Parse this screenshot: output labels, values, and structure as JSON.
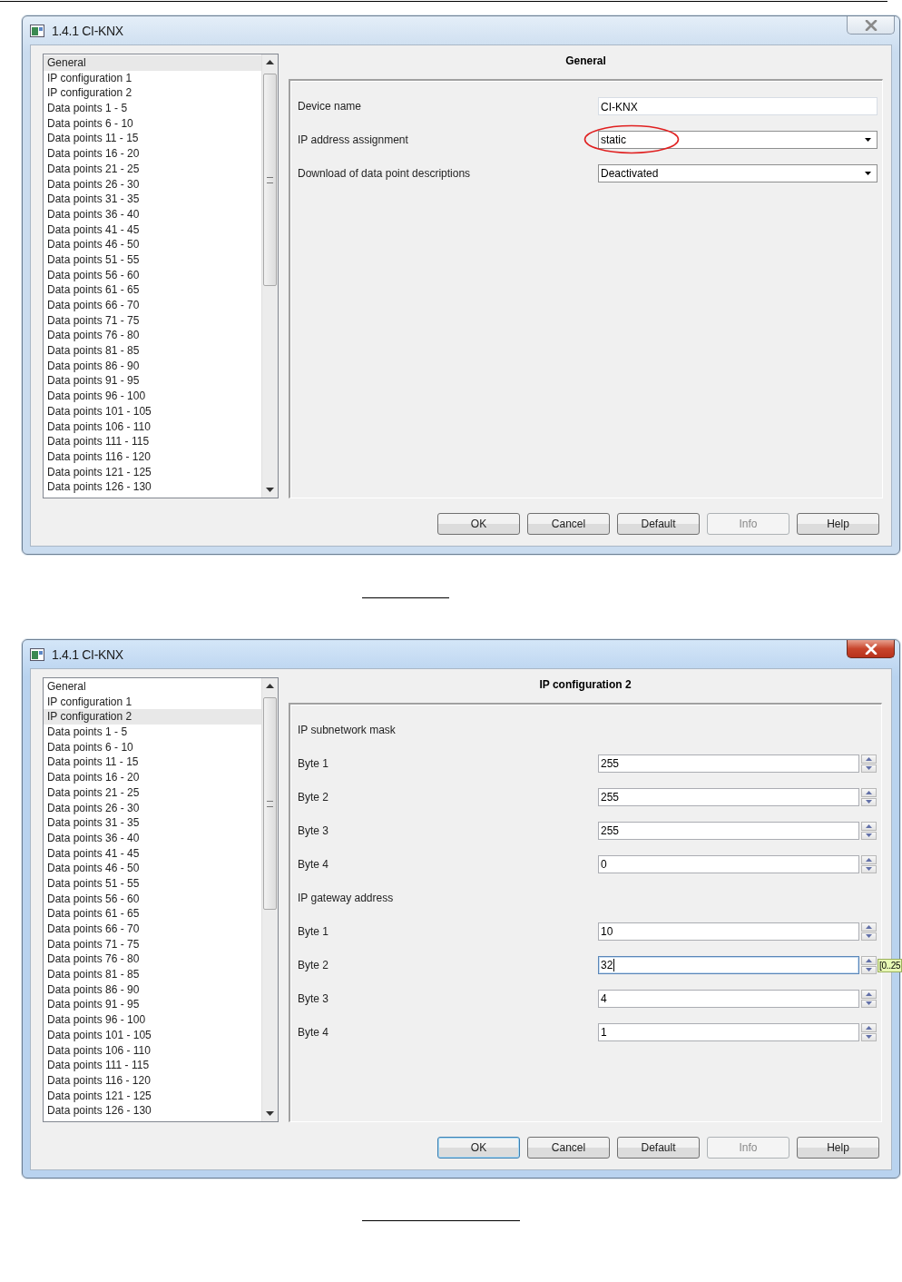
{
  "dialogs": [
    {
      "title": "1.4.1 CI-KNX",
      "active": false,
      "nav": [
        {
          "label": "General",
          "selected": true
        },
        {
          "label": "IP configuration 1",
          "selected": false
        },
        {
          "label": "IP configuration 2",
          "selected": false
        },
        {
          "label": "Data points 1 - 5",
          "selected": false
        },
        {
          "label": "Data points 6 - 10",
          "selected": false
        },
        {
          "label": "Data points 11 - 15",
          "selected": false
        },
        {
          "label": "Data points 16 - 20",
          "selected": false
        },
        {
          "label": "Data points 21 - 25",
          "selected": false
        },
        {
          "label": "Data points 26 - 30",
          "selected": false
        },
        {
          "label": "Data points 31 - 35",
          "selected": false
        },
        {
          "label": "Data points 36 - 40",
          "selected": false
        },
        {
          "label": "Data points 41 - 45",
          "selected": false
        },
        {
          "label": "Data points 46 - 50",
          "selected": false
        },
        {
          "label": "Data points 51 - 55",
          "selected": false
        },
        {
          "label": "Data points 56 - 60",
          "selected": false
        },
        {
          "label": "Data points 61 - 65",
          "selected": false
        },
        {
          "label": "Data points 66 - 70",
          "selected": false
        },
        {
          "label": "Data points 71 - 75",
          "selected": false
        },
        {
          "label": "Data points 76 - 80",
          "selected": false
        },
        {
          "label": "Data points 81 - 85",
          "selected": false
        },
        {
          "label": "Data points 86 - 90",
          "selected": false
        },
        {
          "label": "Data points 91 - 95",
          "selected": false
        },
        {
          "label": "Data points 96 - 100",
          "selected": false
        },
        {
          "label": "Data points 101 - 105",
          "selected": false
        },
        {
          "label": "Data points 106 - 110",
          "selected": false
        },
        {
          "label": "Data points 111 - 115",
          "selected": false
        },
        {
          "label": "Data points 116 - 120",
          "selected": false
        },
        {
          "label": "Data points 121 - 125",
          "selected": false
        },
        {
          "label": "Data points 126 - 130",
          "selected": false
        }
      ],
      "panel_title": "General",
      "params": [
        {
          "kind": "text",
          "label": "Device name",
          "value": "CI-KNX"
        },
        {
          "kind": "dropdown",
          "label": "IP address assignment",
          "value": "static",
          "circled": true
        },
        {
          "kind": "dropdown",
          "label": "Download of data point descriptions",
          "value": "Deactivated",
          "circled": false
        }
      ],
      "buttons": [
        {
          "label": "OK",
          "disabled": false,
          "default": false
        },
        {
          "label": "Cancel",
          "disabled": false,
          "default": false
        },
        {
          "label": "Default",
          "disabled": false,
          "default": false
        },
        {
          "label": "Info",
          "disabled": true,
          "default": false
        },
        {
          "label": "Help",
          "disabled": false,
          "default": false
        }
      ]
    },
    {
      "title": "1.4.1 CI-KNX",
      "active": true,
      "nav": [
        {
          "label": "General",
          "selected": false
        },
        {
          "label": "IP configuration 1",
          "selected": false
        },
        {
          "label": "IP configuration 2",
          "selected": true
        },
        {
          "label": "Data points 1 - 5",
          "selected": false
        },
        {
          "label": "Data points 6 - 10",
          "selected": false
        },
        {
          "label": "Data points 11 - 15",
          "selected": false
        },
        {
          "label": "Data points 16 - 20",
          "selected": false
        },
        {
          "label": "Data points 21 - 25",
          "selected": false
        },
        {
          "label": "Data points 26 - 30",
          "selected": false
        },
        {
          "label": "Data points 31 - 35",
          "selected": false
        },
        {
          "label": "Data points 36 - 40",
          "selected": false
        },
        {
          "label": "Data points 41 - 45",
          "selected": false
        },
        {
          "label": "Data points 46 - 50",
          "selected": false
        },
        {
          "label": "Data points 51 - 55",
          "selected": false
        },
        {
          "label": "Data points 56 - 60",
          "selected": false
        },
        {
          "label": "Data points 61 - 65",
          "selected": false
        },
        {
          "label": "Data points 66 - 70",
          "selected": false
        },
        {
          "label": "Data points 71 - 75",
          "selected": false
        },
        {
          "label": "Data points 76 - 80",
          "selected": false
        },
        {
          "label": "Data points 81 - 85",
          "selected": false
        },
        {
          "label": "Data points 86 - 90",
          "selected": false
        },
        {
          "label": "Data points 91 - 95",
          "selected": false
        },
        {
          "label": "Data points 96 - 100",
          "selected": false
        },
        {
          "label": "Data points 101 - 105",
          "selected": false
        },
        {
          "label": "Data points 106 - 110",
          "selected": false
        },
        {
          "label": "Data points 111 - 115",
          "selected": false
        },
        {
          "label": "Data points 116 - 120",
          "selected": false
        },
        {
          "label": "Data points 121 - 125",
          "selected": false
        },
        {
          "label": "Data points 126 - 130",
          "selected": false
        }
      ],
      "panel_title": "IP configuration 2",
      "params": [
        {
          "kind": "heading",
          "label": "IP subnetwork mask"
        },
        {
          "kind": "spin",
          "label": "Byte 1",
          "value": "255",
          "focused": false
        },
        {
          "kind": "spin",
          "label": "Byte 2",
          "value": "255",
          "focused": false
        },
        {
          "kind": "spin",
          "label": "Byte 3",
          "value": "255",
          "focused": false
        },
        {
          "kind": "spin",
          "label": "Byte 4",
          "value": "0",
          "focused": false
        },
        {
          "kind": "heading",
          "label": "IP gateway address"
        },
        {
          "kind": "spin",
          "label": "Byte 1",
          "value": "10",
          "focused": false
        },
        {
          "kind": "spin",
          "label": "Byte 2",
          "value": "32",
          "focused": true,
          "range_hint": "[0..25"
        },
        {
          "kind": "spin",
          "label": "Byte 3",
          "value": "4",
          "focused": false
        },
        {
          "kind": "spin",
          "label": "Byte 4",
          "value": "1",
          "focused": false
        }
      ],
      "buttons": [
        {
          "label": "OK",
          "disabled": false,
          "default": true
        },
        {
          "label": "Cancel",
          "disabled": false,
          "default": false
        },
        {
          "label": "Default",
          "disabled": false,
          "default": false
        },
        {
          "label": "Info",
          "disabled": true,
          "default": false
        },
        {
          "label": "Help",
          "disabled": false,
          "default": false
        }
      ]
    }
  ]
}
